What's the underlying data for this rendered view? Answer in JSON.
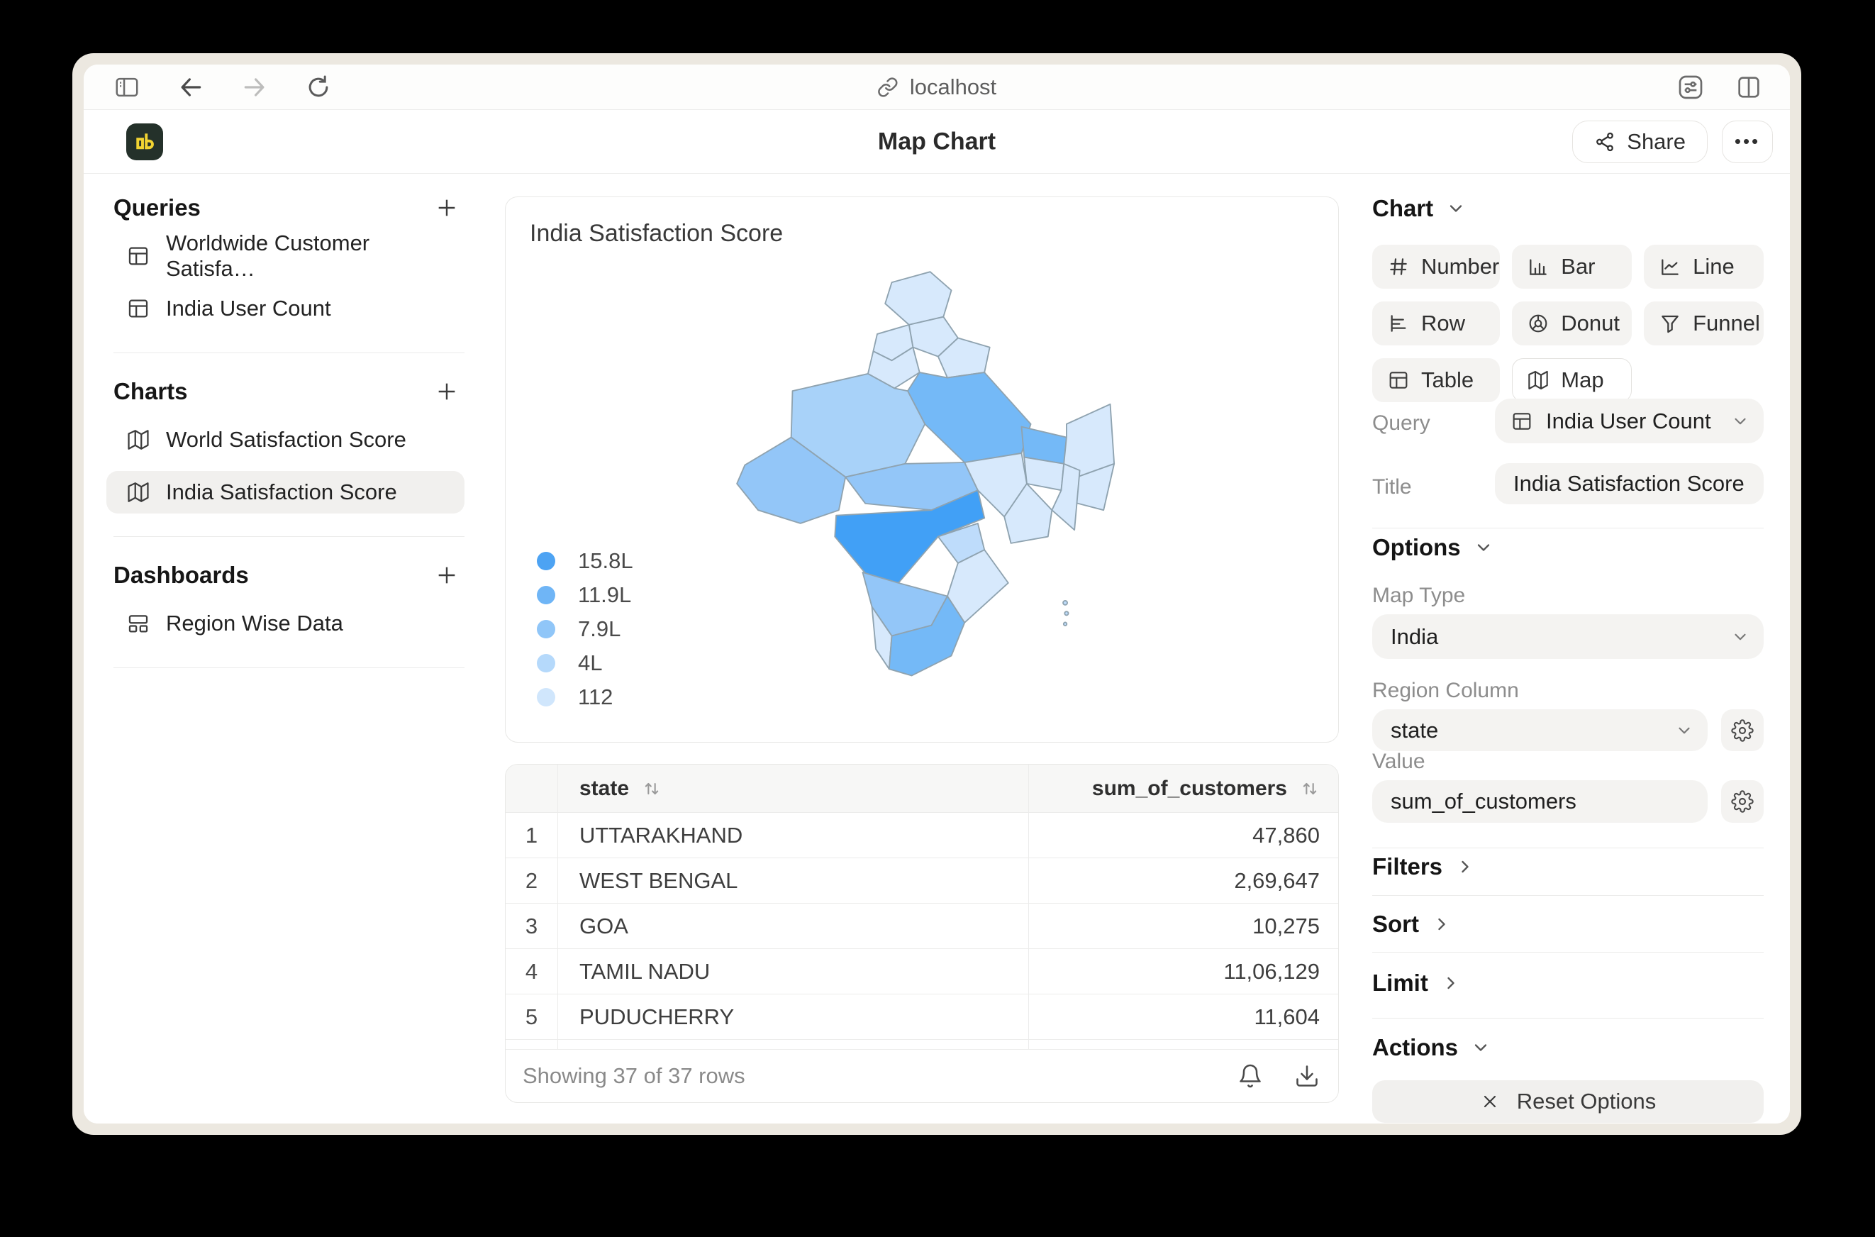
{
  "browser": {
    "url": "localhost"
  },
  "header": {
    "title": "Map Chart",
    "share_label": "Share",
    "more_label": "•••"
  },
  "sidebar": {
    "sections": [
      {
        "title": "Queries",
        "items": [
          {
            "label": "Worldwide Customer Satisfa…"
          },
          {
            "label": "India User Count"
          }
        ]
      },
      {
        "title": "Charts",
        "items": [
          {
            "label": "World Satisfaction Score"
          },
          {
            "label": "India Satisfaction Score",
            "selected": true
          }
        ]
      },
      {
        "title": "Dashboards",
        "items": [
          {
            "label": "Region Wise Data"
          }
        ]
      }
    ]
  },
  "chart_card": {
    "title": "India Satisfaction Score"
  },
  "chart_data": {
    "type": "map",
    "title": "India Satisfaction Score",
    "map_type": "India",
    "region_column": "state",
    "value_column": "sum_of_customers",
    "legend": [
      {
        "label": "15.8L",
        "color": "#4da3f3"
      },
      {
        "label": "11.9L",
        "color": "#6fb5f6"
      },
      {
        "label": "7.9L",
        "color": "#90c6f8"
      },
      {
        "label": "4L",
        "color": "#b5d9fb"
      },
      {
        "label": "112",
        "color": "#d0e6fc"
      }
    ],
    "highlight_note": "Maharashtra darkest; UP, Bihar, Tamil Nadu medium; Gujarat, MP, Rajasthan, Karnataka lighter medium; rest lightest",
    "table": {
      "columns": [
        "state",
        "sum_of_customers"
      ],
      "rows": [
        {
          "n": "1",
          "state": "UTTARAKHAND",
          "value": "47,860"
        },
        {
          "n": "2",
          "state": "WEST BENGAL",
          "value": "2,69,647"
        },
        {
          "n": "3",
          "state": "GOA",
          "value": "10,275"
        },
        {
          "n": "4",
          "state": "TAMIL NADU",
          "value": "11,06,129"
        },
        {
          "n": "5",
          "state": "PUDUCHERRY",
          "value": "11,604"
        }
      ],
      "status": "Showing 37 of 37 rows"
    }
  },
  "panel": {
    "chart_section": "Chart",
    "chart_types": [
      {
        "label": "Number"
      },
      {
        "label": "Bar"
      },
      {
        "label": "Line"
      },
      {
        "label": "Row"
      },
      {
        "label": "Donut"
      },
      {
        "label": "Funnel"
      },
      {
        "label": "Table"
      },
      {
        "label": "Map",
        "selected": true
      }
    ],
    "query_label": "Query",
    "query_value": "India User Count",
    "title_label": "Title",
    "title_value": "India Satisfaction Score",
    "options_section": "Options",
    "map_type_label": "Map Type",
    "map_type_value": "India",
    "region_label": "Region Column",
    "region_value": "state",
    "value_label": "Value",
    "value_value": "sum_of_customers",
    "filters_section": "Filters",
    "sort_section": "Sort",
    "limit_section": "Limit",
    "actions_section": "Actions",
    "reset_label": "Reset Options"
  }
}
